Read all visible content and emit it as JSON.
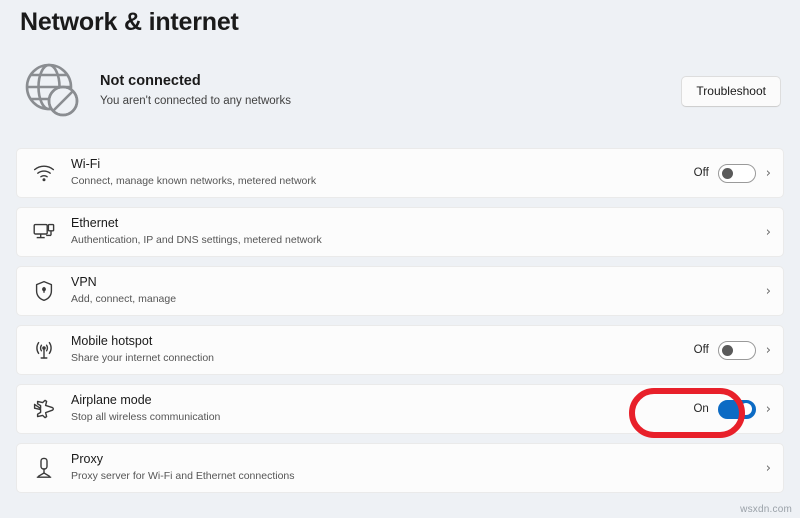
{
  "page": {
    "title": "Network & internet"
  },
  "status": {
    "icon": "globe-blocked-icon",
    "title": "Not connected",
    "subtitle": "You aren't connected to any networks",
    "troubleshoot_label": "Troubleshoot"
  },
  "rows": [
    {
      "icon": "wifi-icon",
      "title": "Wi-Fi",
      "subtitle": "Connect, manage known networks, metered network",
      "toggle_state": "Off",
      "toggle_on": false,
      "has_toggle": true,
      "chevron": "›"
    },
    {
      "icon": "ethernet-icon",
      "title": "Ethernet",
      "subtitle": "Authentication, IP and DNS settings, metered network",
      "toggle_state": "",
      "toggle_on": false,
      "has_toggle": false,
      "chevron": "›"
    },
    {
      "icon": "shield-icon",
      "title": "VPN",
      "subtitle": "Add, connect, manage",
      "toggle_state": "",
      "toggle_on": false,
      "has_toggle": false,
      "chevron": "›"
    },
    {
      "icon": "hotspot-icon",
      "title": "Mobile hotspot",
      "subtitle": "Share your internet connection",
      "toggle_state": "Off",
      "toggle_on": false,
      "has_toggle": true,
      "chevron": "›"
    },
    {
      "icon": "airplane-icon",
      "title": "Airplane mode",
      "subtitle": "Stop all wireless communication",
      "toggle_state": "On",
      "toggle_on": true,
      "has_toggle": true,
      "chevron": "›",
      "highlighted": true
    },
    {
      "icon": "proxy-icon",
      "title": "Proxy",
      "subtitle": "Proxy server for Wi-Fi and Ethernet connections",
      "toggle_state": "",
      "toggle_on": false,
      "has_toggle": false,
      "chevron": "›"
    }
  ],
  "watermark": "wsxdn.com",
  "colors": {
    "page_background": "#eef1f5",
    "card_background": "#fcfcfc",
    "toggle_on": "#0c6bc4",
    "highlight": "#e8202a",
    "text_primary": "#1a1a1a",
    "text_secondary": "#555555"
  }
}
